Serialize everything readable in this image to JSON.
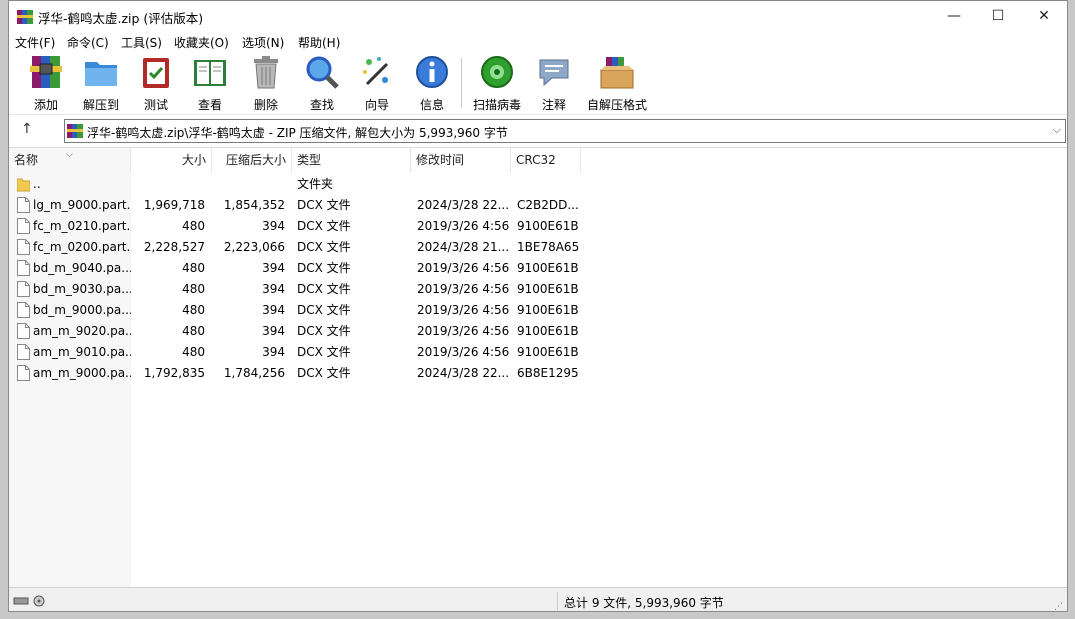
{
  "window": {
    "title": "浮华-鹤鸣太虚.zip (评估版本)",
    "min": "—",
    "max": "☐",
    "close": "✕"
  },
  "menu": [
    "文件(F)",
    "命令(C)",
    "工具(S)",
    "收藏夹(O)",
    "选项(N)",
    "帮助(H)"
  ],
  "toolbar": [
    {
      "label": "添加",
      "icon": "winrar-add-icon"
    },
    {
      "label": "解压到",
      "icon": "folder-extract-icon"
    },
    {
      "label": "测试",
      "icon": "clipboard-test-icon"
    },
    {
      "label": "查看",
      "icon": "book-view-icon"
    },
    {
      "label": "删除",
      "icon": "trash-icon"
    },
    {
      "label": "查找",
      "icon": "magnifier-icon"
    },
    {
      "label": "向导",
      "icon": "wand-icon"
    },
    {
      "label": "信息",
      "icon": "info-icon"
    },
    {
      "label": "扫描病毒",
      "icon": "virus-scan-icon"
    },
    {
      "label": "注释",
      "icon": "comment-icon"
    },
    {
      "label": "自解压格式",
      "icon": "sfx-box-icon"
    }
  ],
  "address": {
    "up": "↑",
    "path": "浮华-鹤鸣太虚.zip\\浮华-鹤鸣太虚 - ZIP 压缩文件, 解包大小为 5,993,960 字节",
    "dropdown": "⌵"
  },
  "columns": {
    "name": "名称",
    "size": "大小",
    "packed": "压缩后大小",
    "type": "类型",
    "modified": "修改时间",
    "crc": "CRC32",
    "sort": "⌵"
  },
  "files": [
    {
      "name": "..",
      "size": "",
      "packed": "",
      "type": "文件夹",
      "modified": "",
      "crc": "",
      "folder": true
    },
    {
      "name": "lg_m_9000.part...",
      "size": "1,969,718",
      "packed": "1,854,352",
      "type": "DCX 文件",
      "modified": "2024/3/28 22...",
      "crc": "C2B2DD..."
    },
    {
      "name": "fc_m_0210.part...",
      "size": "480",
      "packed": "394",
      "type": "DCX 文件",
      "modified": "2019/3/26 4:56",
      "crc": "9100E61B"
    },
    {
      "name": "fc_m_0200.part...",
      "size": "2,228,527",
      "packed": "2,223,066",
      "type": "DCX 文件",
      "modified": "2024/3/28 21...",
      "crc": "1BE78A65"
    },
    {
      "name": "bd_m_9040.pa...",
      "size": "480",
      "packed": "394",
      "type": "DCX 文件",
      "modified": "2019/3/26 4:56",
      "crc": "9100E61B"
    },
    {
      "name": "bd_m_9030.pa...",
      "size": "480",
      "packed": "394",
      "type": "DCX 文件",
      "modified": "2019/3/26 4:56",
      "crc": "9100E61B"
    },
    {
      "name": "bd_m_9000.pa...",
      "size": "480",
      "packed": "394",
      "type": "DCX 文件",
      "modified": "2019/3/26 4:56",
      "crc": "9100E61B"
    },
    {
      "name": "am_m_9020.pa...",
      "size": "480",
      "packed": "394",
      "type": "DCX 文件",
      "modified": "2019/3/26 4:56",
      "crc": "9100E61B"
    },
    {
      "name": "am_m_9010.pa...",
      "size": "480",
      "packed": "394",
      "type": "DCX 文件",
      "modified": "2019/3/26 4:56",
      "crc": "9100E61B"
    },
    {
      "name": "am_m_9000.pa...",
      "size": "1,792,835",
      "packed": "1,784,256",
      "type": "DCX 文件",
      "modified": "2024/3/28 22...",
      "crc": "6B8E1295"
    }
  ],
  "status": {
    "summary": "总计 9 文件, 5,993,960 字节",
    "grip": "⋰"
  }
}
